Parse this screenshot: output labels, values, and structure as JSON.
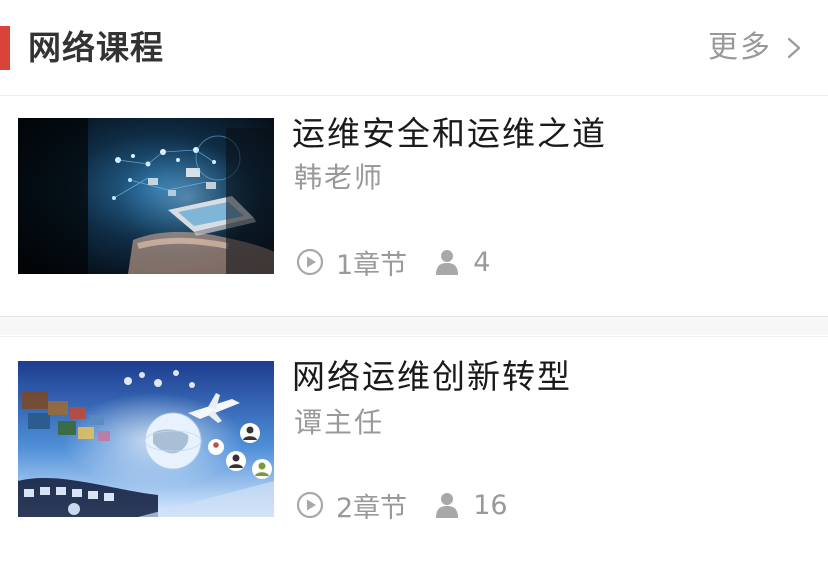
{
  "header": {
    "title": "网络课程",
    "more_label": "更多",
    "accent_color": "#d9443a",
    "more_icon": "chevron-right-icon"
  },
  "courses": [
    {
      "title": "运维安全和运维之道",
      "teacher": "韩老师",
      "chapters": "1章节",
      "learners": "4",
      "thumbnail": "hand-with-network-hologram"
    },
    {
      "title": "网络运维创新转型",
      "teacher": "谭主任",
      "chapters": "2章节",
      "learners": "16",
      "thumbnail": "globe-with-media-tiles-and-airplane"
    }
  ],
  "icons": {
    "chapters": "play-circle-icon",
    "learners": "user-icon"
  },
  "colors": {
    "muted_text": "#999999",
    "title_text": "#1a1a1a"
  }
}
